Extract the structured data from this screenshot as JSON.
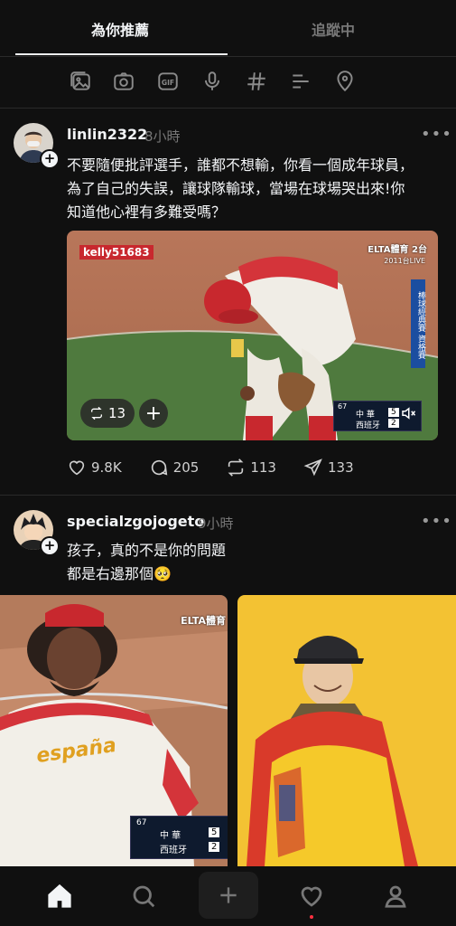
{
  "tabs": {
    "for_you": "為你推薦",
    "following": "追蹤中"
  },
  "toolbar": {
    "icons": [
      "gallery-icon",
      "camera-icon",
      "gif-icon",
      "mic-icon",
      "hashtag-icon",
      "poll-icon",
      "location-icon"
    ]
  },
  "posts": [
    {
      "username": "linlin2322",
      "time": "8小時",
      "more": "•••",
      "text": "不要隨便批評選手，誰都不想輸，你看一個成年球員，\n為了自己的失誤，讓球隊輸球，當場在球場哭出來!你\n知道他心裡有多難受嗎？",
      "media": {
        "watermark": "kelly51683",
        "channel": "ELTA體育 2台",
        "live_label": "2011台LIVE",
        "side_caption": "棒球經典賽 資格賽",
        "score": {
          "inning": "67",
          "team1": "中 華",
          "score1": "5",
          "team2": "西班牙",
          "score2": "2"
        },
        "repost_count": "13"
      },
      "actions": {
        "likes": "9.8K",
        "comments": "205",
        "reposts": "113",
        "shares": "133"
      }
    },
    {
      "username": "specialzgojogeto",
      "time": "9小時",
      "more": "•••",
      "text": "孩子，真的不是你的問題\n都是右邊那個🥺",
      "media": {
        "jersey_text": "españa",
        "channel": "ELTA體育",
        "score": {
          "inning": "67",
          "team1": "中 華",
          "score1": "5",
          "team2": "西班牙",
          "score2": "2"
        }
      }
    }
  ],
  "colors": {
    "background": "#101010",
    "text": "#f3f5f7",
    "muted": "#777777",
    "accent_red": "#ff3040"
  },
  "bottom_nav": [
    "home-icon",
    "search-icon",
    "compose-icon",
    "heart-icon",
    "profile-icon"
  ]
}
